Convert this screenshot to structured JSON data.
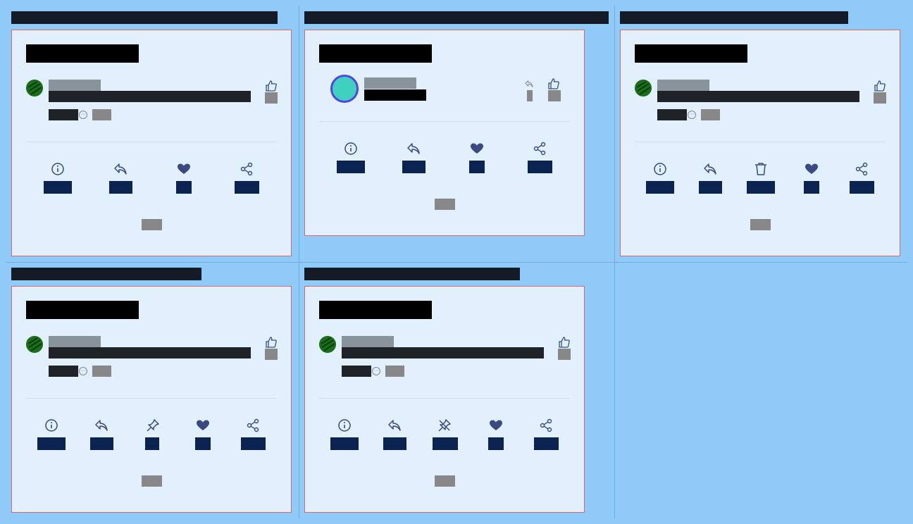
{
  "theme": {
    "background": "#90caf9",
    "card_background": "#e1f0fc",
    "card_border": "#d96a6a",
    "title_bar": "#141b26",
    "action_label": "#0b2350",
    "icon_color": "#3a4a80",
    "avatar_green": "#1b6e1b",
    "avatar_teal": "#40d0c0",
    "avatar_ring": "#4f46e5"
  },
  "icons": {
    "info": "info-icon",
    "reply": "reply-icon",
    "delete": "trash-icon",
    "pin": "pin-icon",
    "unpin": "unpin-icon",
    "like": "heart-icon",
    "share": "share-icon",
    "thumb": "thumbs-up-icon"
  },
  "cells": [
    {
      "id": "c1",
      "actions": [
        "info",
        "reply",
        "like",
        "share"
      ]
    },
    {
      "id": "c2",
      "actions": [
        "info",
        "reply",
        "like",
        "share"
      ]
    },
    {
      "id": "c3",
      "actions": [
        "info",
        "reply",
        "delete",
        "like",
        "share"
      ]
    },
    {
      "id": "c4",
      "actions": [
        "info",
        "reply",
        "pin",
        "like",
        "share"
      ]
    },
    {
      "id": "c5",
      "actions": [
        "info",
        "reply",
        "unpin",
        "like",
        "share"
      ]
    }
  ]
}
